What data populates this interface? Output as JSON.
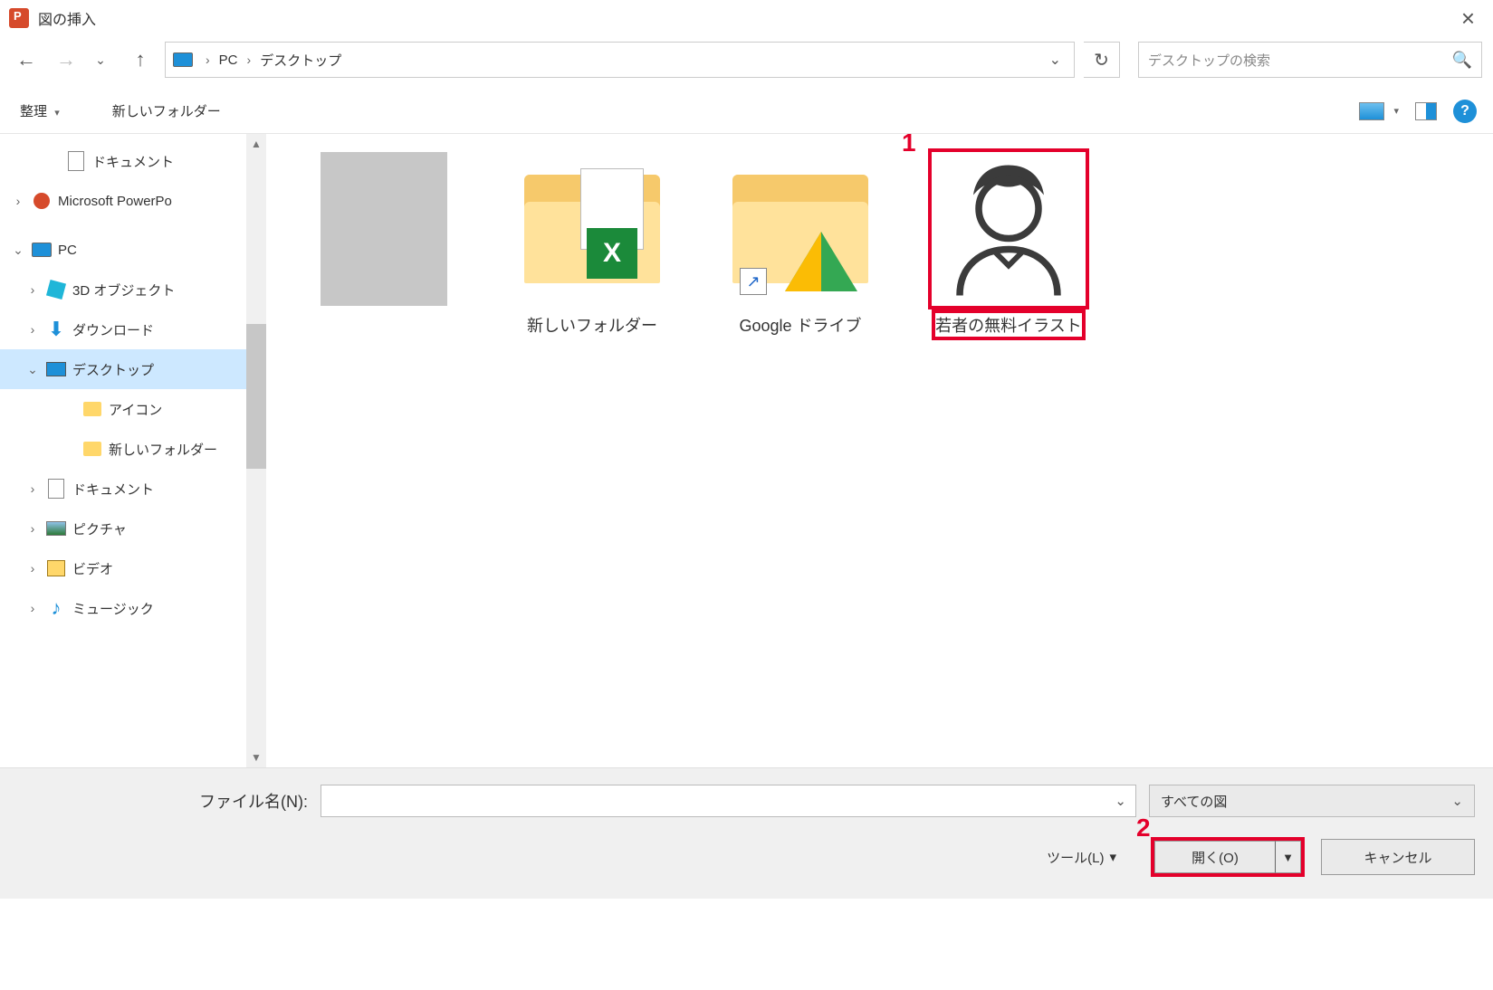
{
  "window": {
    "title": "図の挿入"
  },
  "breadcrumb": {
    "root": "PC",
    "current": "デスクトップ"
  },
  "search": {
    "placeholder": "デスクトップの検索"
  },
  "toolbar": {
    "organize": "整理",
    "new_folder": "新しいフォルダー"
  },
  "tree": {
    "documents_top": "ドキュメント",
    "powerpoint": "Microsoft PowerPo",
    "pc": "PC",
    "objects3d": "3D オブジェクト",
    "downloads": "ダウンロード",
    "desktop": "デスクトップ",
    "desktop_child_icon": "アイコン",
    "desktop_child_newfolder": "新しいフォルダー",
    "documents": "ドキュメント",
    "pictures": "ピクチャ",
    "videos": "ビデオ",
    "music": "ミュージック"
  },
  "items": [
    {
      "label": ""
    },
    {
      "label": "新しいフォルダー"
    },
    {
      "label": "Google ドライブ"
    },
    {
      "label": "若者の無料イラスト"
    }
  ],
  "annotations": {
    "marker1": "1",
    "marker2": "2"
  },
  "footer": {
    "filename_label": "ファイル名(N):",
    "filetype": "すべての図",
    "tools": "ツール(L)",
    "open": "開く(O)",
    "cancel": "キャンセル"
  }
}
